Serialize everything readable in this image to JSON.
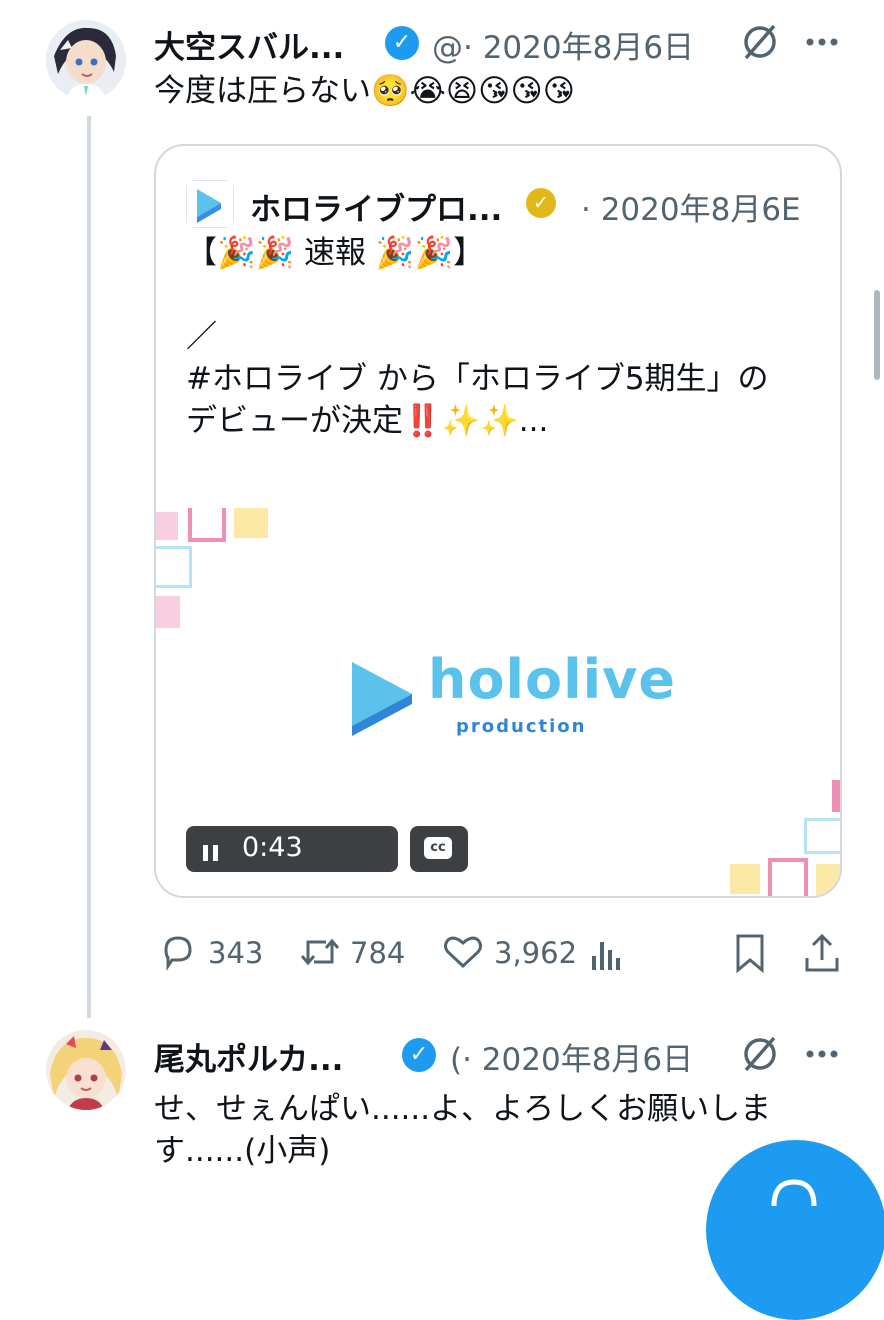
{
  "tweet1": {
    "display_name": "大空スバル...",
    "handle_date": "@· 2020年8月6日",
    "text": "今度は圧らない🥺😭😫😘😘😘"
  },
  "quote": {
    "display_name": "ホロライブプロ...",
    "date": "· 2020年8月6E",
    "text": "【🎉🎉 速報 🎉🎉】\n\n／\n#ホロライブ から「ホロライブ5期生」の\nデビューが決定‼️✨✨...",
    "media": {
      "logo_word": "hololive",
      "logo_sub": "production",
      "time": "0:43",
      "cc": "cc"
    }
  },
  "actions": {
    "replies": "343",
    "retweets": "784",
    "likes": "3,962"
  },
  "tweet2": {
    "display_name": "尾丸ポルカ...",
    "handle_date": "(· 2020年8月6日",
    "text": "せ、せぇんぱい......よ、よろしくお願いしま\nす......(小声)"
  },
  "colors": {
    "accent": "#1d9bf0",
    "verified_gold": "#e2b719",
    "muted_text": "#536471",
    "border": "#cfd9de",
    "hololive_blue": "#5bc2ec"
  }
}
